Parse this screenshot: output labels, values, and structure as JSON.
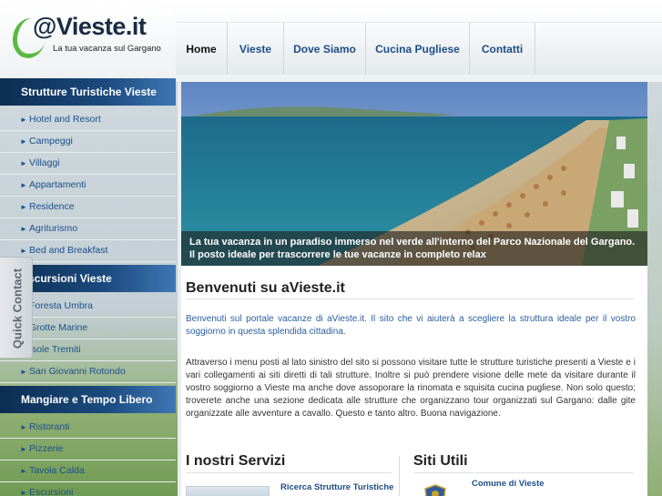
{
  "logo": {
    "title": "@Vieste.it",
    "tagline": "La tua vacanza sul Gargano"
  },
  "nav": {
    "items": [
      {
        "label": "Home",
        "active": true
      },
      {
        "label": "Vieste"
      },
      {
        "label": "Dove Siamo"
      },
      {
        "label": "Cucina Pugliese"
      },
      {
        "label": "Contatti"
      }
    ]
  },
  "sidebar": {
    "sections": [
      {
        "title": "Strutture Turistiche Vieste",
        "items": [
          "Hotel and Resort",
          "Campeggi",
          "Villaggi",
          "Appartamenti",
          "Residence",
          "Agriturismo",
          "Bed and Breakfast"
        ]
      },
      {
        "title": "Escursioni Vieste",
        "items": [
          "Foresta Umbra",
          "Grotte Marine",
          "Isole Tremiti",
          "San Giovanni Rotondo"
        ]
      },
      {
        "title": "Mangiare e Tempo Libero",
        "items": [
          "Ristoranti",
          "Pizzerie",
          "Tavola Calda",
          "Escursioni"
        ]
      }
    ],
    "quick_contact": "Quick Contact"
  },
  "hero": {
    "caption": "La tua vacanza in un paradiso immerso nel verde all'interno del Parco Nazionale del Gargano. Il posto ideale per trascorrere le tue vacanze in completo relax"
  },
  "content": {
    "welcome_title": "Benvenuti su aVieste.it",
    "intro": "Benvenuti sul portale vacanze di aVieste.it. Il sito che vi aiuterà a scegliere la struttura ideale per il vostro soggiorno in questa splendida cittadina.",
    "body": "Attraverso i menu posti al lato sinistro del sito si possono visitare tutte le strutture turistiche presenti a Vieste e i vari collegamenti ai siti diretti di tali strutture. Inoltre si può prendere visione delle mete da visitare durante il vostro soggiorno a Vieste ma anche dove assoporare la rinomata e squisita cucina pugliese. Non solo questo; troverete anche una sezione dedicata alle strutture che organizzano tour organizzati sul Gargano: dalle gite organizzate alle avventure a cavallo. Questo e tanto altro. Buona navigazione.",
    "services_title": "I nostri Servizi",
    "services_link": "Ricerca Strutture Turistiche",
    "utils_title": "Siti Utili",
    "utils_link": "Comune di Vieste"
  },
  "colors": {
    "nav_link": "#1e4d86",
    "sidebar_header": "#0c2d52",
    "intro_text": "#2a5ea0",
    "logo_green": "#5bb843"
  }
}
